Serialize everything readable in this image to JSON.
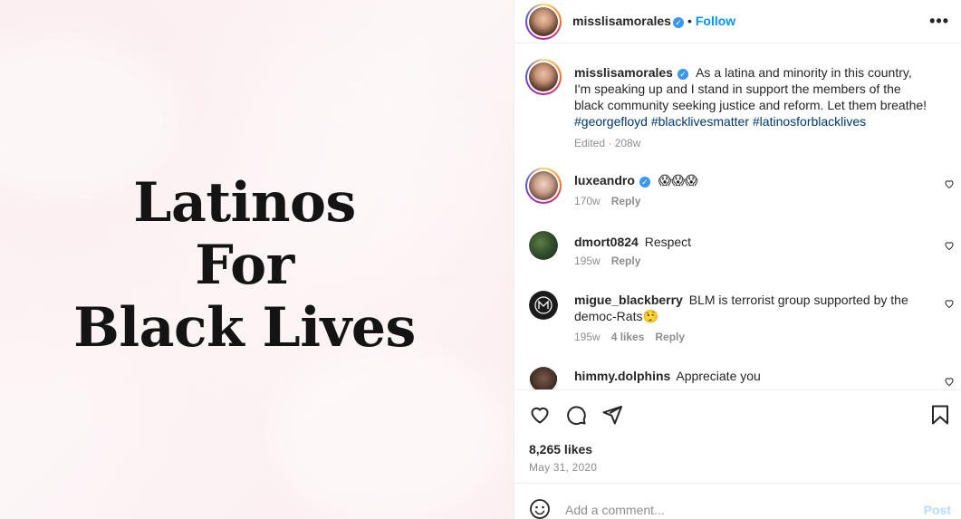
{
  "image": {
    "lines": [
      "Latinos",
      "For",
      "Black Lives"
    ]
  },
  "header": {
    "username": "misslisamorales",
    "separator": "•",
    "follow_label": "Follow",
    "more_icon": "more-horizontal-icon"
  },
  "caption": {
    "username": "misslisamorales",
    "text": "As a latina and minority in this country, I'm speaking up and I stand in support the members of the black community seeking justice and reform. Let them breathe!",
    "hashtags": [
      "#georgefloyd",
      "#blacklivesmatter",
      "#latinosforblacklives"
    ],
    "edited_label": "Edited",
    "time": "208w"
  },
  "comments": [
    {
      "username": "luxeandro",
      "verified": true,
      "text": "😱😱😱",
      "time": "170w",
      "likes": "",
      "reply_label": "Reply"
    },
    {
      "username": "dmort0824",
      "verified": false,
      "text": "Respect",
      "time": "195w",
      "likes": "",
      "reply_label": "Reply"
    },
    {
      "username": "migue_blackberry",
      "verified": false,
      "text": "BLM is terrorist group supported by the democ-Rats🤥",
      "time": "195w",
      "likes": "4 likes",
      "reply_label": "Reply"
    },
    {
      "username": "himmy.dolphins",
      "verified": false,
      "text": "Appreciate you",
      "time": "",
      "likes": "",
      "reply_label": ""
    }
  ],
  "actions": {
    "like_icon": "heart-icon",
    "comment_icon": "comment-icon",
    "share_icon": "share-icon",
    "save_icon": "bookmark-icon",
    "likes": "8,265 likes",
    "date": "May 31, 2020"
  },
  "add_comment": {
    "placeholder": "Add a comment...",
    "post_label": "Post",
    "emoji_icon": "emoji-icon"
  },
  "colors": {
    "accent": "#0095f6",
    "verified": "#3897f0",
    "hashtag": "#00376b",
    "muted": "#8e8e8e",
    "post_disabled": "#b2dffc"
  }
}
